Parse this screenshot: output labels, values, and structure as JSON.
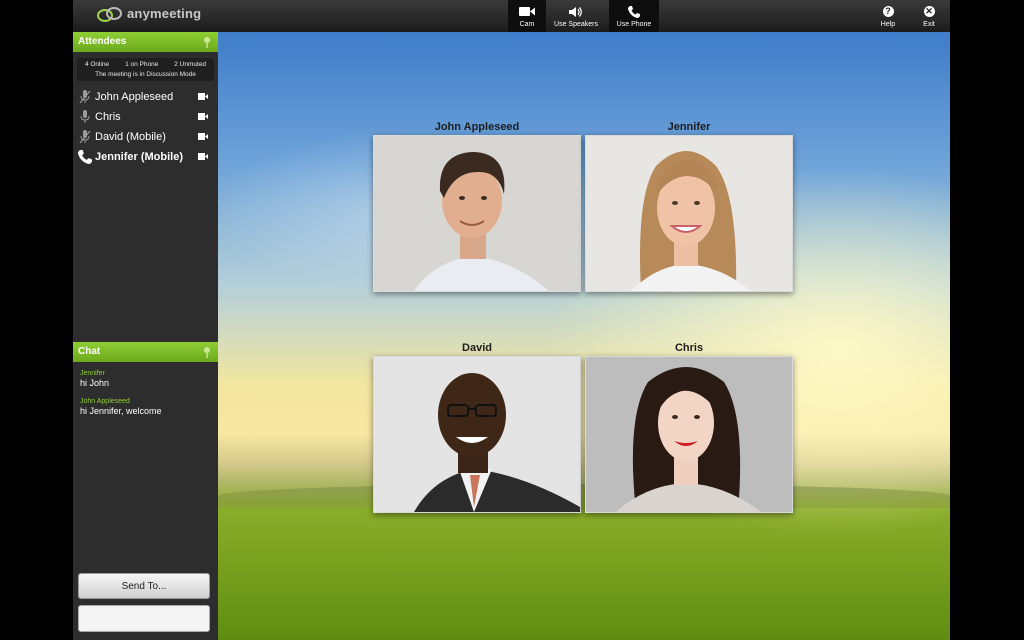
{
  "app": {
    "logo_text": "anymeeting"
  },
  "toolbar": {
    "cam_label": "Cam",
    "speakers_label": "Use Speakers",
    "phone_label": "Use Phone",
    "help_label": "Help",
    "exit_label": "Exit"
  },
  "attendees": {
    "title": "Attendees",
    "stats": {
      "online": "4 Online",
      "phone": "1 on Phone",
      "unmuted": "2 Unmuted",
      "mode": "The meeting is in Discussion Mode"
    },
    "list": [
      {
        "name": "John Appleseed",
        "icon": "mic-muted-icon"
      },
      {
        "name": "Chris",
        "icon": "mic-icon"
      },
      {
        "name": "David (Mobile)",
        "icon": "mic-muted-icon"
      },
      {
        "name": "Jennifer (Mobile)",
        "icon": "phone-icon"
      }
    ]
  },
  "chat": {
    "title": "Chat",
    "messages": [
      {
        "sender": "Jennifer",
        "text": "hi John"
      },
      {
        "sender": "John Appleseed",
        "text": "hi Jennifer, welcome"
      }
    ],
    "send_label": "Send To..."
  },
  "videos": [
    {
      "label": "John Appleseed"
    },
    {
      "label": "Jennifer"
    },
    {
      "label": "David"
    },
    {
      "label": "Chris"
    }
  ],
  "colors": {
    "accent": "#7dbd27",
    "topbar": "#1c1c1c",
    "sidebar": "#2d2d2d"
  }
}
